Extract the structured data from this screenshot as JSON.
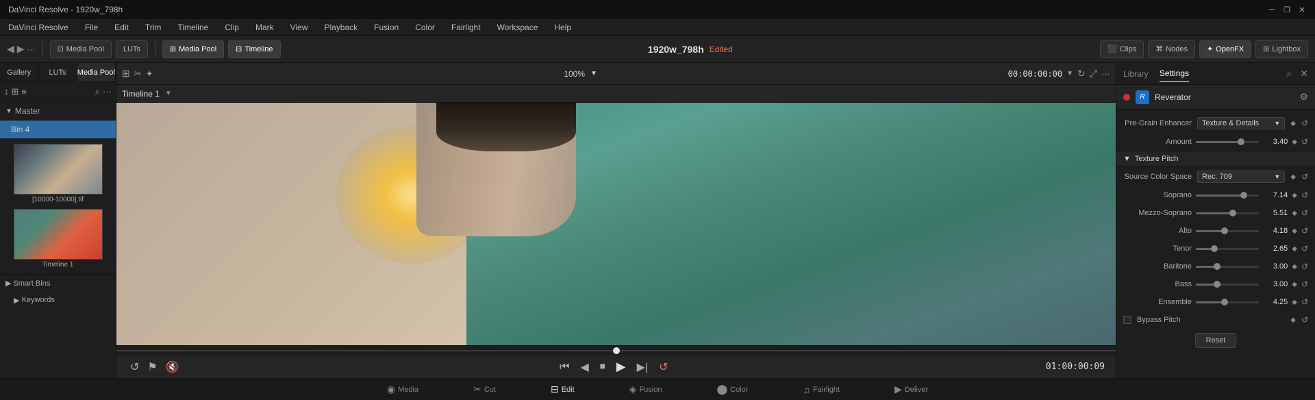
{
  "window": {
    "title": "DaVinci Resolve - 1920w_798h",
    "controls": [
      "minimize",
      "maximize",
      "close"
    ]
  },
  "menu": {
    "items": [
      "DaVinci Resolve",
      "File",
      "Edit",
      "Trim",
      "Timeline",
      "Clip",
      "Mark",
      "View",
      "Playback",
      "Fusion",
      "Color",
      "Fairlight",
      "Workspace",
      "Help"
    ]
  },
  "top_toolbar": {
    "media_pool_label": "Media Pool",
    "luts_label": "LUTs",
    "media_pool_icon": "▦",
    "timeline_icon": "⊟",
    "timeline_label": "Timeline",
    "project_name": "1920w_798h",
    "edited_badge": "Edited",
    "clips_label": "Clips",
    "nodes_label": "Nodes",
    "openfx_label": "OpenFX",
    "lightbox_label": "Lightbox",
    "zoom_level": "100%"
  },
  "left_panel": {
    "tabs": [
      "Gallery",
      "LUTs",
      "Media Pool"
    ],
    "active_tab": "Media Pool",
    "bin_header": "Master",
    "bin_item": "Bin 4",
    "thumbnails": [
      {
        "label": "[10000-10000].tif"
      },
      {
        "label": "Timeline 1"
      }
    ],
    "smart_bins": "Smart Bins",
    "keywords": "Keywords"
  },
  "preview": {
    "toolbar": {
      "zoom": "100%",
      "timeline_name": "Timeline 1",
      "timecode": "00:00:00:00",
      "tools": [
        "transform",
        "grid",
        "list",
        "search",
        "more"
      ]
    },
    "transport": {
      "timecode_display": "01:00:00:09",
      "buttons": [
        "rewind",
        "step_back",
        "stop",
        "play",
        "step_forward",
        "loop"
      ]
    }
  },
  "right_panel": {
    "tabs": [
      {
        "label": "Library",
        "active": false
      },
      {
        "label": "Settings",
        "active": true
      }
    ],
    "fx_header": {
      "title": "Reverator"
    },
    "pre_grain": {
      "label": "Pre-Grain Enhancer",
      "dropdown_value": "Texture & Details",
      "amount_label": "Amount",
      "amount_value": "3.40"
    },
    "texture_pitch": {
      "section_label": "Texture Pitch",
      "source_color_space": {
        "label": "Source Color Space",
        "value": "Rec. 709"
      },
      "sliders": [
        {
          "label": "Soprano",
          "value": "7.14",
          "fill_pct": 72
        },
        {
          "label": "Mezzo-Soprano",
          "value": "5.51",
          "fill_pct": 55
        },
        {
          "label": "Alto",
          "value": "4.18",
          "fill_pct": 42
        },
        {
          "label": "Tenor",
          "value": "2.65",
          "fill_pct": 26
        },
        {
          "label": "Baritone",
          "value": "3.00",
          "fill_pct": 30
        },
        {
          "label": "Bass",
          "value": "3.00",
          "fill_pct": 30
        },
        {
          "label": "Ensemble",
          "value": "4.25",
          "fill_pct": 42
        }
      ],
      "bypass_pitch": {
        "label": "Bypass Pitch",
        "checked": false
      }
    },
    "reset_btn": "Reset"
  },
  "bottom_nav": {
    "items": [
      {
        "label": "Media",
        "icon": "◉"
      },
      {
        "label": "Cut",
        "icon": "✂"
      },
      {
        "label": "Edit",
        "icon": "⊟",
        "active": true
      },
      {
        "label": "Fusion",
        "icon": "◈"
      },
      {
        "label": "Color",
        "icon": "⬤"
      },
      {
        "label": "Fairlight",
        "icon": "♫"
      },
      {
        "label": "Deliver",
        "icon": "▶"
      }
    ]
  }
}
